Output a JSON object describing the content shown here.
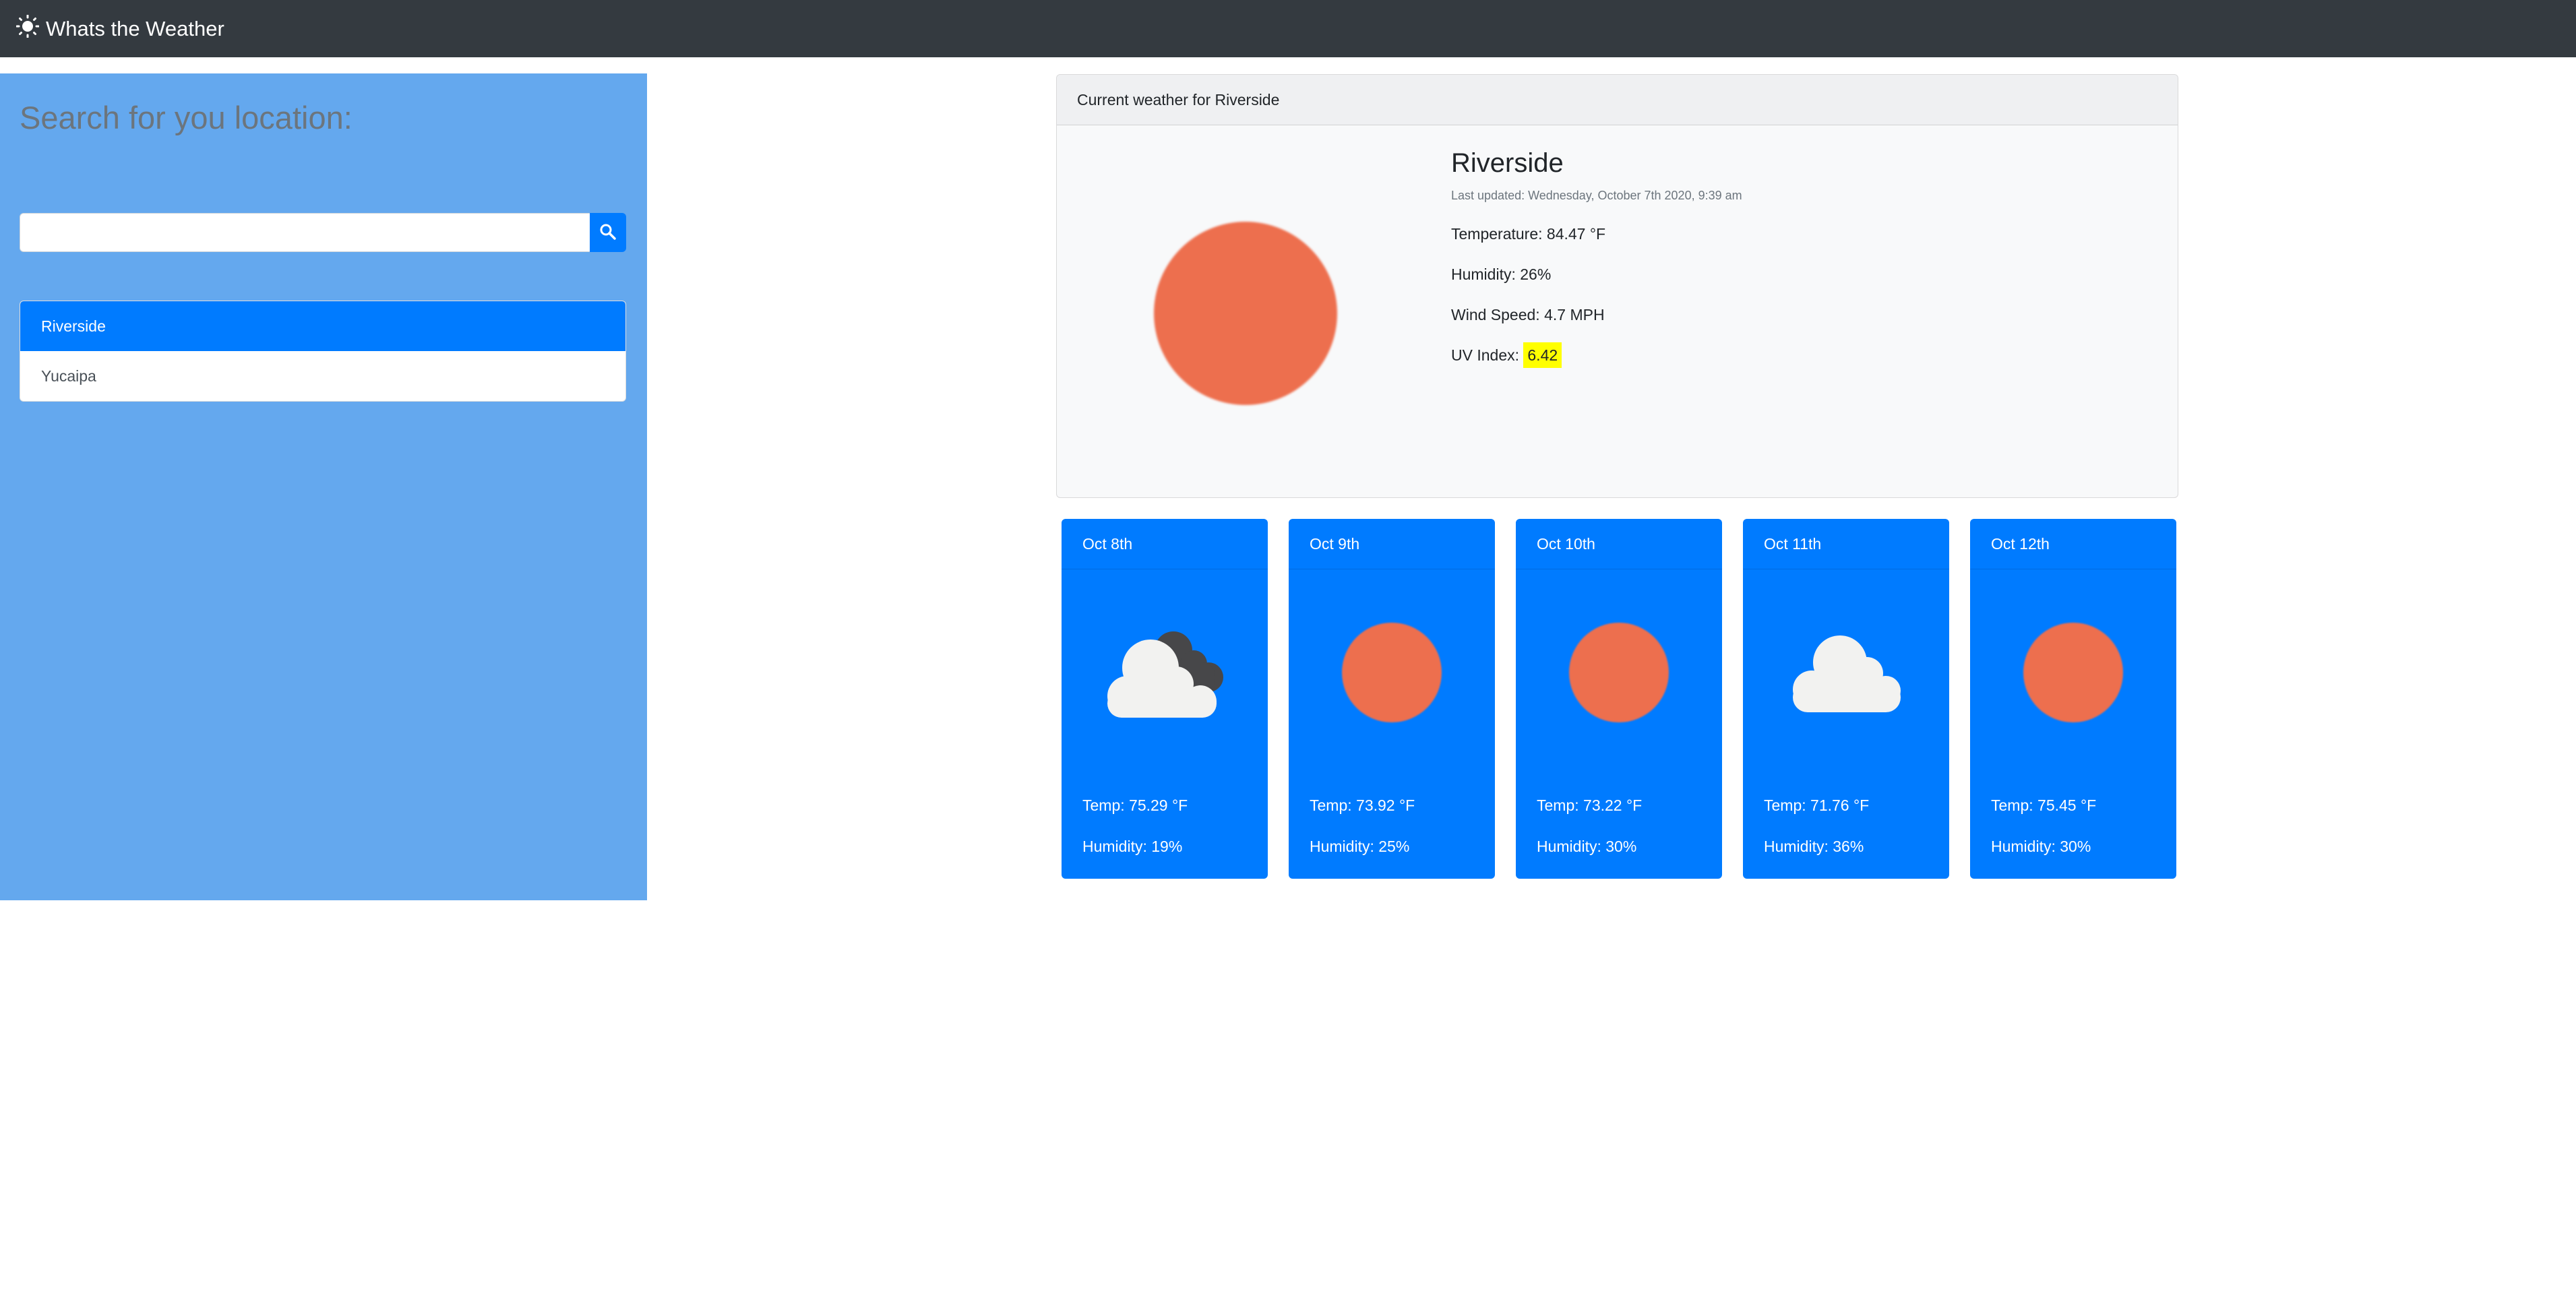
{
  "navbar": {
    "brand": "Whats the Weather",
    "icon": "sun-icon"
  },
  "sidebar": {
    "heading": "Search for you location:",
    "search": {
      "value": "",
      "placeholder": "",
      "button_icon": "search-icon"
    },
    "history": [
      {
        "label": "Riverside",
        "active": true
      },
      {
        "label": "Yucaipa",
        "active": false
      }
    ]
  },
  "current": {
    "header": "Current weather for Riverside",
    "city": "Riverside",
    "updated": "Last updated: Wednesday, October 7th 2020, 9:39 am",
    "icon": "sun",
    "temperature": "Temperature: 84.47 °F",
    "humidity": "Humidity: 26%",
    "wind": "Wind Speed: 4.7 MPH",
    "uv_label": "UV Index:",
    "uv_value": "6.42",
    "uv_color": "#ffff00"
  },
  "forecast": [
    {
      "date": "Oct 8th",
      "icon": "broken-clouds",
      "temp": "Temp: 75.29 °F",
      "humidity": "Humidity: 19%"
    },
    {
      "date": "Oct 9th",
      "icon": "sun",
      "temp": "Temp: 73.92 °F",
      "humidity": "Humidity: 25%"
    },
    {
      "date": "Oct 10th",
      "icon": "sun",
      "temp": "Temp: 73.22 °F",
      "humidity": "Humidity: 30%"
    },
    {
      "date": "Oct 11th",
      "icon": "cloud",
      "temp": "Temp: 71.76 °F",
      "humidity": "Humidity: 36%"
    },
    {
      "date": "Oct 12th",
      "icon": "sun",
      "temp": "Temp: 75.45 °F",
      "humidity": "Humidity: 30%"
    }
  ],
  "colors": {
    "navbar": "#343a40",
    "sidebar": "#64a8ee",
    "primary": "#007bff",
    "sun": "#ed6f4e"
  }
}
